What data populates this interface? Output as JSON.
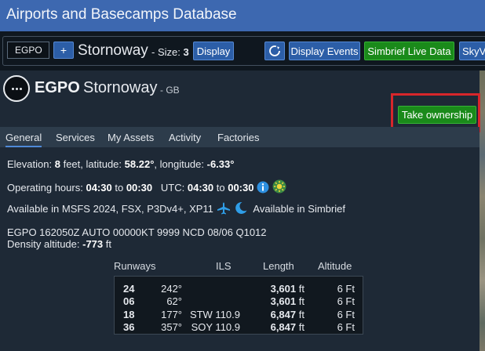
{
  "app": {
    "title": "Airports and Basecamps Database"
  },
  "toolbar": {
    "icao_value": "EGPO",
    "plus_label": "+",
    "airport_name": "Stornoway",
    "size_prefix": "- Size:",
    "size_value": "3",
    "display_label": "Display",
    "display_events_label": "Display Events",
    "simbrief_label": "Simbrief Live Data",
    "skyve_label": "SkyVe"
  },
  "airport": {
    "icao": "EGPO",
    "name": "Stornoway",
    "country": "- GB",
    "take_ownership_label": "Take ownership"
  },
  "tabs": [
    {
      "label": "General",
      "active": true
    },
    {
      "label": "Services"
    },
    {
      "label": "My Assets"
    },
    {
      "label": "Activity"
    },
    {
      "label": "Factories"
    }
  ],
  "general": {
    "elevation_label": "Elevation:",
    "elevation_value": "8",
    "elevation_unit": "feet, latitude:",
    "latitude": "58.22°",
    "longitude_label": ", longitude:",
    "longitude": "-6.33°",
    "hours_label": "Operating hours:",
    "hours_open": "04:30",
    "to_1": "to",
    "hours_close": "00:30",
    "utc_label": "UTC:",
    "utc_open": "04:30",
    "to_2": "to",
    "utc_close": "00:30",
    "available_label": "Available in MSFS 2024, FSX, P3Dv4+, XP11",
    "simbrief_available": "Available in Simbrief",
    "metar": "EGPO 162050Z AUTO 00000KT 9999 NCD 08/06 Q1012",
    "density_label": "Density altitude:",
    "density_value": "-773",
    "density_unit": "ft"
  },
  "runways": {
    "headers": {
      "runways": "Runways",
      "ils": "ILS",
      "length": "Length",
      "altitude": "Altitude"
    },
    "rows": [
      {
        "id": "24",
        "heading": "242°",
        "ils": "",
        "length": "3,601",
        "unit": "ft",
        "altitude": "6 Ft"
      },
      {
        "id": "06",
        "heading": "62°",
        "ils": "",
        "length": "3,601",
        "unit": "ft",
        "altitude": "6 Ft"
      },
      {
        "id": "18",
        "heading": "177°",
        "ils": "STW 110.9",
        "length": "6,847",
        "unit": "ft",
        "altitude": "6 Ft"
      },
      {
        "id": "36",
        "heading": "357°",
        "ils": "SOY 110.9",
        "length": "6,847",
        "unit": "ft",
        "altitude": "6 Ft"
      }
    ]
  },
  "colors": {
    "accent_blue": "#3d68b0",
    "button_blue": "#2c5ea7",
    "button_green": "#1a8a1a",
    "highlight_red": "#d8262b"
  },
  "icons": {
    "refresh": "refresh-icon",
    "info": "info-icon",
    "sun": "sun-icon",
    "airplane": "airplane-icon",
    "moon": "moon-icon",
    "more": "more-icon"
  }
}
